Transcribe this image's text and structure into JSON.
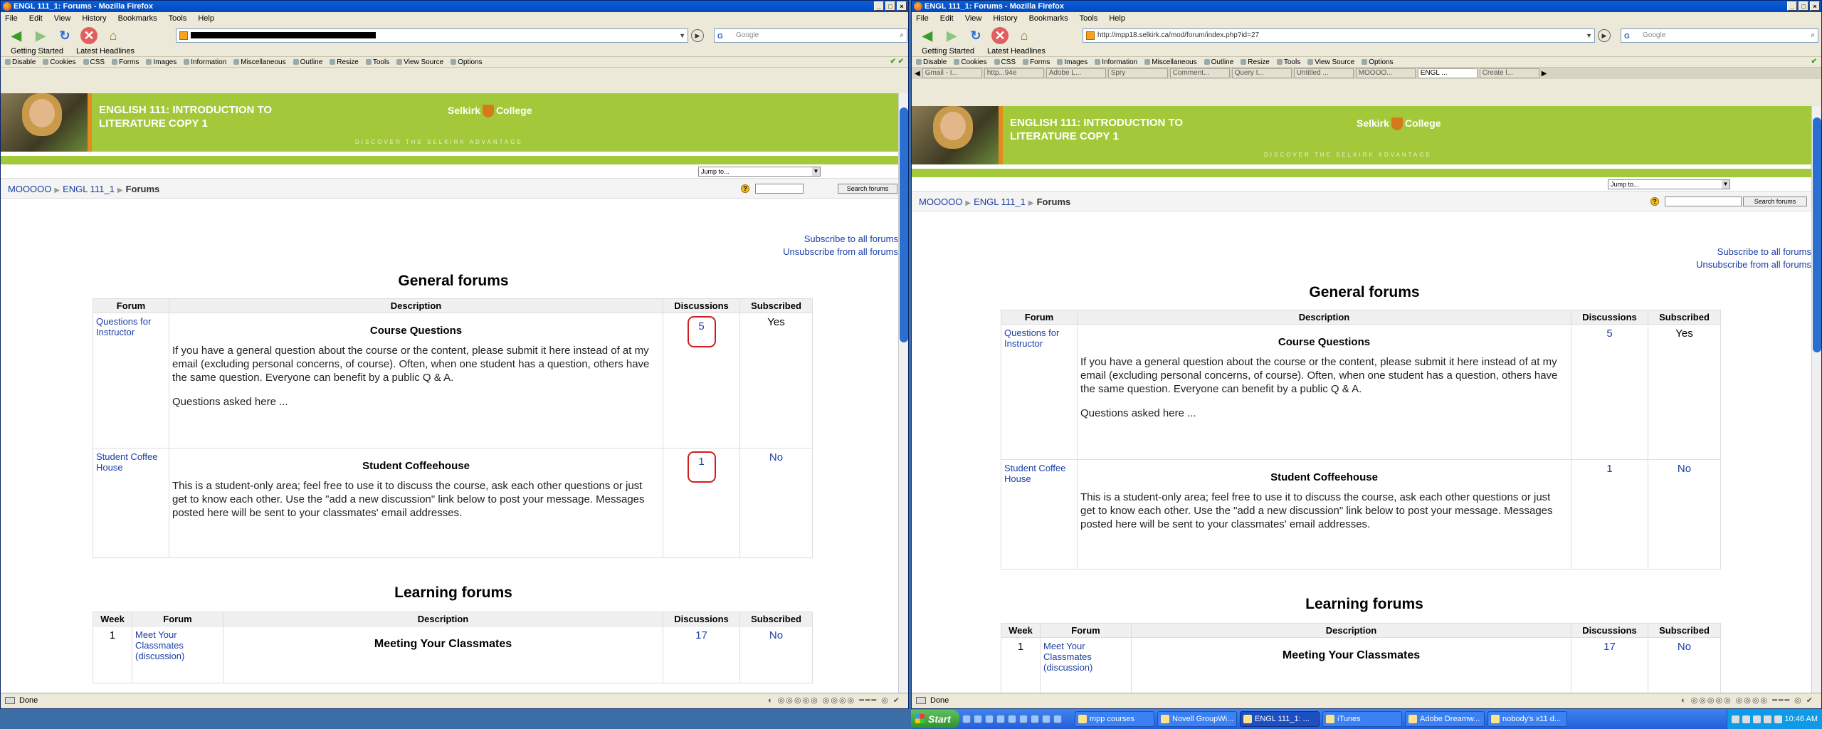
{
  "left_window": {
    "title": "ENGL 111_1: Forums - Mozilla Firefox",
    "url": "",
    "tabs": []
  },
  "right_window": {
    "title": "ENGL 111_1: Forums - Mozilla Firefox",
    "url": "http://mpp18.selkirk.ca/mod/forum/index.php?id=27",
    "tabs": [
      "Gmail - I...",
      "http...94e",
      "Adobe L...",
      "Spry",
      "Comment...",
      "Query t...",
      "Untitled ...",
      "MOOOO...",
      "ENGL ...",
      "Create l..."
    ]
  },
  "menu": [
    "File",
    "Edit",
    "View",
    "History",
    "Bookmarks",
    "Tools",
    "Help"
  ],
  "search_placeholder": "Google",
  "bookmarks": [
    "Getting Started",
    "Latest Headlines"
  ],
  "devtools": [
    "Disable",
    "Cookies",
    "CSS",
    "Forms",
    "Images",
    "Information",
    "Miscellaneous",
    "Outline",
    "Resize",
    "Tools",
    "View Source",
    "Options"
  ],
  "page": {
    "banner_title_1": "ENGLISH 111: INTRODUCTION TO",
    "banner_title_2": "LITERATURE COPY 1",
    "logo_left": "Selkirk",
    "logo_right": "College",
    "tagline": "DISCOVER THE SELKIRK ADVANTAGE",
    "jump_to": "Jump to...",
    "breadcrumb": [
      "MOOOOO",
      "ENGL 111_1",
      "Forums"
    ],
    "search_forums": "Search forums",
    "subscribe_all": "Subscribe to all forums",
    "unsubscribe_all": "Unsubscribe from all forums",
    "general_heading": "General forums",
    "general_cols": [
      "Forum",
      "Description",
      "Discussions",
      "Subscribed"
    ],
    "general_rows": [
      {
        "forum": "Questions for Instructor",
        "name": "Course Questions",
        "desc": "If you have a general question about the course or the content, please submit it here instead of at my email (excluding personal concerns, of course). Often, when one student has a question, others have the same question. Everyone can benefit by a public Q & A.",
        "desc2": "Questions asked here ...",
        "discussions": "5",
        "subscribed": "Yes"
      },
      {
        "forum": "Student Coffee House",
        "name": "Student Coffeehouse",
        "desc": "This is a student-only area; feel free to use it to discuss the course, ask each other questions or just get to know each other. Use the \"add a new discussion\" link below to post your message. Messages posted here will be sent to your classmates' email addresses.",
        "discussions": "1",
        "subscribed": "No"
      }
    ],
    "learning_heading": "Learning forums",
    "learning_cols": [
      "Week",
      "Forum",
      "Description",
      "Discussions",
      "Subscribed"
    ],
    "learning_rows": [
      {
        "week": "1",
        "forum": "Meet Your Classmates (discussion)",
        "name": "Meeting Your Classmates",
        "discussions": "17",
        "subscribed": "No"
      }
    ]
  },
  "status": "Done",
  "taskbar": {
    "start": "Start",
    "tasks": [
      "mpp courses",
      "Novell GroupWi...",
      "ENGL 111_1: ...",
      "iTunes",
      "Adobe Dreamw...",
      "nobody's x11 d..."
    ],
    "clock": "10:46 AM"
  }
}
